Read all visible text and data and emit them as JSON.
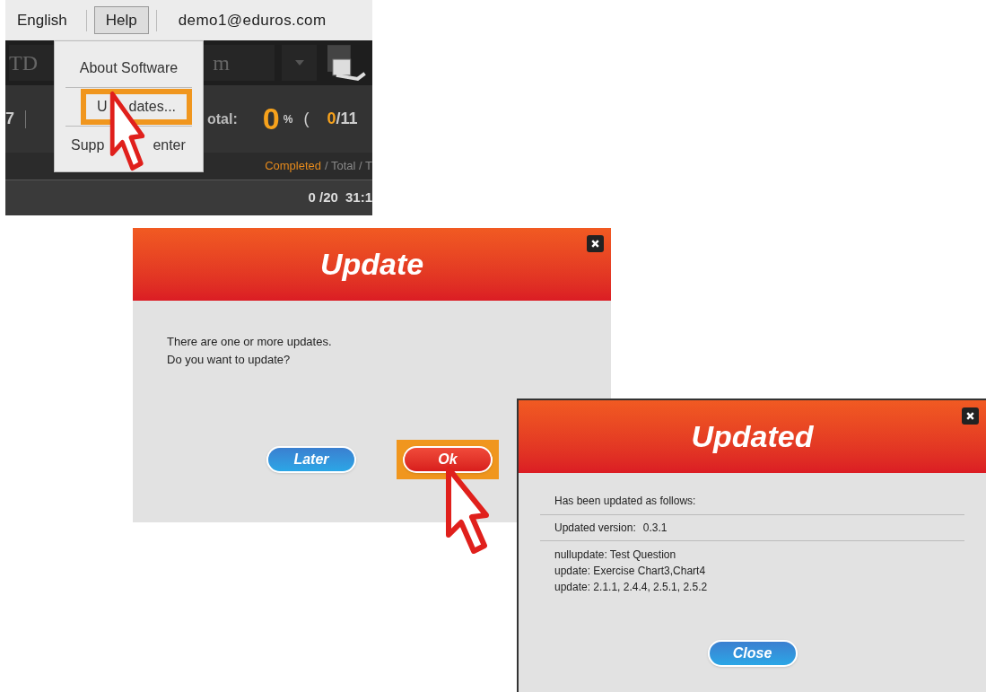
{
  "menu_bar": {
    "items": [
      {
        "label": "English",
        "selected": false
      },
      {
        "label": "Help",
        "selected": true
      }
    ],
    "account": "demo1@eduros.com"
  },
  "app_toolbar": {
    "fields": [
      "TD",
      "m"
    ]
  },
  "stats": {
    "count": "7",
    "total_label": "otal:",
    "percent": "0",
    "percent_sign": "%",
    "paren": "(",
    "done": "0",
    "rest": "/11"
  },
  "legend": {
    "completed": "Completed",
    "rest": "/ Total / T"
  },
  "row": {
    "progress": "0 /20",
    "time": "31:1"
  },
  "help_menu": {
    "items": [
      {
        "parts": [
          "About Software"
        ],
        "highlighted": false
      },
      {
        "parts": [
          "U",
          "dates..."
        ],
        "highlighted": true
      },
      {
        "parts": [
          "Supp",
          "enter"
        ],
        "highlighted": false
      }
    ]
  },
  "update_dialog": {
    "title": "Update",
    "message": [
      "There are one or more updates.",
      "Do you want to update?"
    ],
    "buttons": [
      {
        "label": "Later",
        "kind": "secondary",
        "highlighted": false
      },
      {
        "label": "Ok",
        "kind": "primary",
        "highlighted": true
      }
    ]
  },
  "updated_dialog": {
    "title": "Updated",
    "heading": "Has been updated as follows:",
    "version_label": "Updated version:",
    "version": "0.3.1",
    "changes": [
      "nullupdate: Test Question",
      "update: Exercise Chart3,Chart4",
      "update: 2.1.1, 2.4.4, 2.5.1, 2.5.2"
    ],
    "button": "Close"
  }
}
